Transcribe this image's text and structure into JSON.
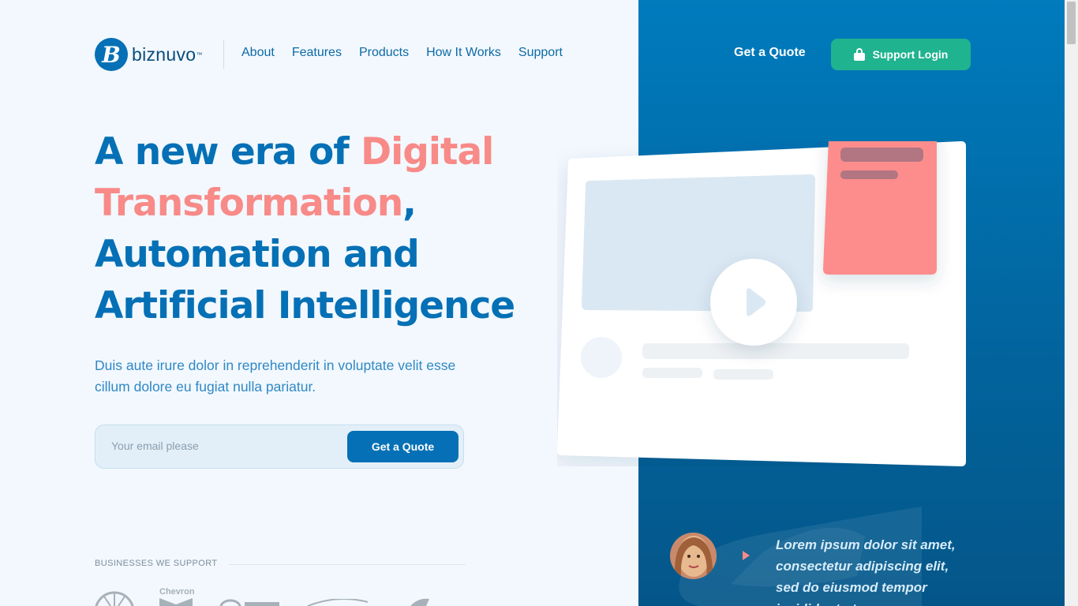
{
  "brand": {
    "name": "biznuvo",
    "mark": "B",
    "tm": "™"
  },
  "nav": {
    "items": [
      "About",
      "Features",
      "Products",
      "How It Works",
      "Support"
    ]
  },
  "header": {
    "quote_link": "Get a Quote",
    "support_label": "Support Login"
  },
  "hero": {
    "line1_pre": "A new era of ",
    "line1_accent": "Digital",
    "line2_accent": "Transformation",
    "line2_post": ",",
    "line3": "Automation and",
    "line4": "Artificial Intelligence",
    "subtext": "Duis aute irure dolor in reprehenderit in voluptate velit esse cillum dolore eu fugiat nulla pariatur."
  },
  "form": {
    "placeholder": "Your email please",
    "button": "Get a Quote"
  },
  "businesses": {
    "label": "BUSINESSES WE SUPPORT",
    "logos": [
      "Chevron"
    ]
  },
  "testimonial": {
    "quote": "Lorem ipsum dolor sit amet, consectetur adipiscing elit, sed do eiusmod tempor incididunt ut"
  },
  "colors": {
    "primary": "#0570b5",
    "accent": "#f88a88",
    "green": "#1fb38f",
    "panel": "#02639c"
  }
}
